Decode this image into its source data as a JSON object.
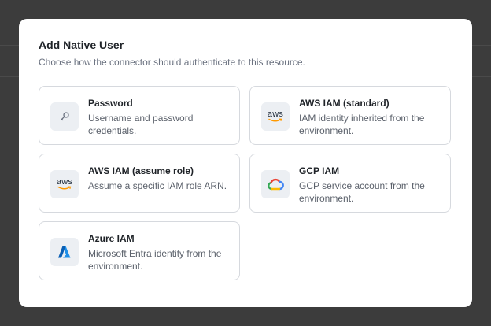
{
  "modal": {
    "title": "Add Native User",
    "subtitle": "Choose how the connector should authenticate to this resource."
  },
  "options": [
    {
      "title": "Password",
      "description": "Username and password credentials.",
      "icon": "key-icon"
    },
    {
      "title": "AWS IAM (standard)",
      "description": "IAM identity inherited from the environment.",
      "icon": "aws-icon",
      "icon_text": "aws"
    },
    {
      "title": "AWS IAM (assume role)",
      "description": "Assume a specific IAM role ARN.",
      "icon": "aws-icon",
      "icon_text": "aws"
    },
    {
      "title": "GCP IAM",
      "description": "GCP service account from the environment.",
      "icon": "google-cloud-icon"
    },
    {
      "title": "Azure IAM",
      "description": "Microsoft Entra identity from the environment.",
      "icon": "azure-icon"
    }
  ],
  "colors": {
    "backdrop": "#3c3c3c",
    "aws_orange": "#ff9900",
    "azure_blue": "#0078d4"
  }
}
